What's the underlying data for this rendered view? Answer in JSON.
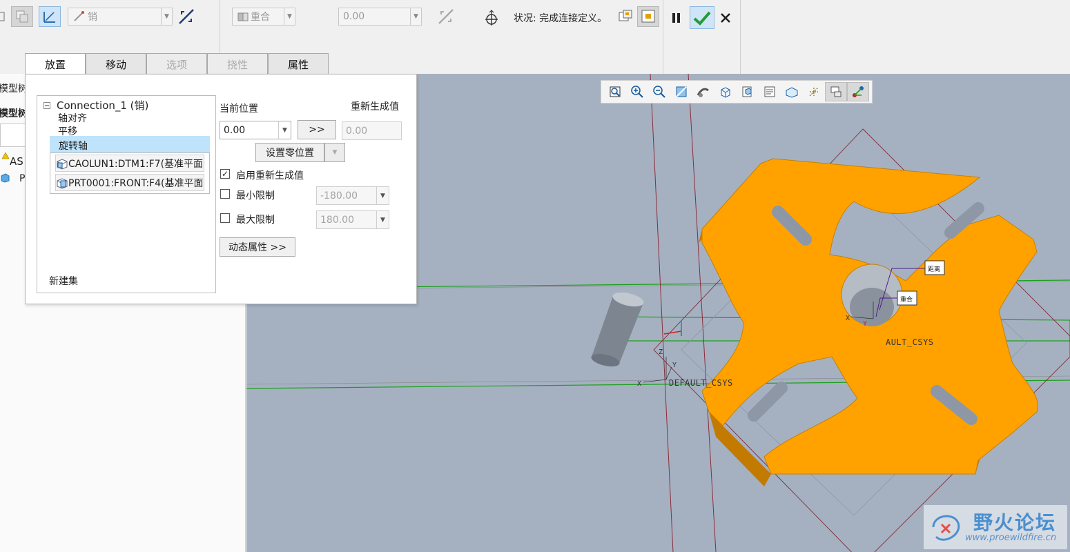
{
  "ribbon": {
    "connection_type": "销",
    "constraint_type": "重合",
    "offset_value": "0.00",
    "status_label": "状况: 完成连接定义。"
  },
  "tabs": [
    {
      "label": "放置",
      "state": "active"
    },
    {
      "label": "移动",
      "state": "normal"
    },
    {
      "label": "选项",
      "state": "disabled"
    },
    {
      "label": "挠性",
      "state": "disabled"
    },
    {
      "label": "属性",
      "state": "normal"
    }
  ],
  "model_tree": {
    "label_1": "模型树",
    "label_2": "模型树",
    "item_1": "AS",
    "item_2": "P"
  },
  "panel": {
    "connection_title": "Connection_1 (销)",
    "constraints": [
      "轴对齐",
      "平移",
      "旋转轴"
    ],
    "selected_constraint": "旋转轴",
    "references": [
      "CAOLUN1:DTM1:F7(基准平面)",
      "PRT0001:FRONT:F4(基准平面)"
    ],
    "new_set": "新建集",
    "current_position_label": "当前位置",
    "current_position_value": "0.00",
    "arrow_button": ">>",
    "regen_value_label": "重新生成值",
    "regen_value": "0.00",
    "set_zero_button": "设置零位置",
    "enable_regen_label": "启用重新生成值",
    "enable_regen_checked": true,
    "min_limit_label": "最小限制",
    "min_limit_value": "-180.00",
    "min_limit_checked": false,
    "max_limit_label": "最大限制",
    "max_limit_value": "180.00",
    "max_limit_checked": false,
    "dynamic_props_button": "动态属性 >>"
  },
  "viewport": {
    "csys_label_1": "DEFAULT_CSYS",
    "csys_label_2": "AULT_CSYS",
    "tag_1": "距离",
    "tag_2": "重合",
    "part_color": "#ffa200",
    "background_color": "#a5b1c1"
  },
  "watermark": {
    "title": "野火论坛",
    "url": "www.proewildfire.cn"
  },
  "colors": {
    "accept_green": "#1e9e35",
    "selection_blue": "#bfe3fb"
  }
}
